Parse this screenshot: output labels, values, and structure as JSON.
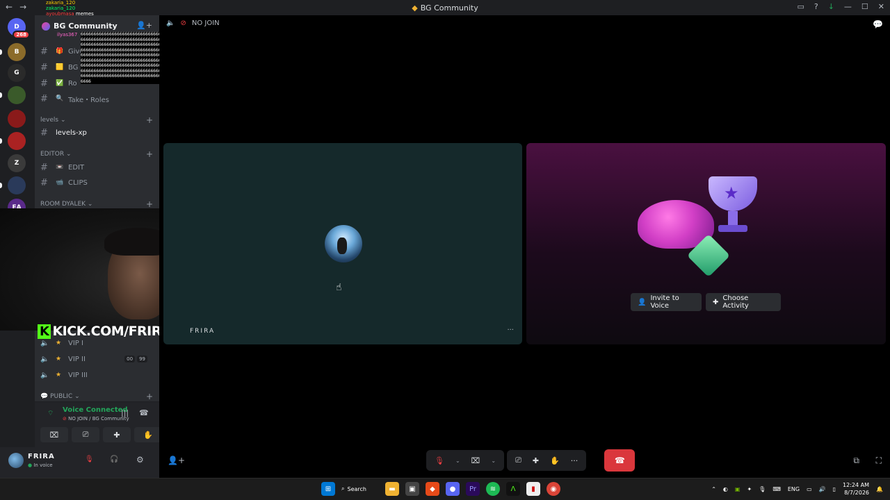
{
  "window": {
    "title": "BG Community",
    "back": "←",
    "forward": "→",
    "inbox_icon": "▭",
    "help_icon": "?",
    "download_icon": "↓",
    "minimize": "—",
    "maximize": "☐",
    "close": "✕"
  },
  "servers": [
    {
      "label": "D",
      "badge": "268",
      "color": "#5865f2"
    },
    {
      "label": "B",
      "badge": "",
      "color": "#8b6b2a"
    },
    {
      "label": "G",
      "badge": "",
      "color": "#2a2a2a"
    },
    {
      "label": "",
      "badge": "",
      "color": "#3a5a2a"
    },
    {
      "label": "",
      "badge": "",
      "color": "#8a1a1a"
    },
    {
      "label": "",
      "badge": "",
      "color": "#aa2222"
    },
    {
      "label": "Z",
      "badge": "",
      "color": "#3a3a3a"
    },
    {
      "label": "",
      "badge": "",
      "color": "#2a3a5a"
    },
    {
      "label": "EA",
      "badge": "",
      "color": "#5a2a8a"
    }
  ],
  "server": {
    "name": "BG Community",
    "invite_icon": "👤+"
  },
  "overlay_chat": {
    "line1": "zakaria_120",
    "line2": "zakaria_120",
    "line3_user": "ayoubmasa",
    "line3_text": "memes",
    "line4": "ilyas367"
  },
  "spam_text": "6666666666666666666666666666666666666666666666666666666666666666666666666666666666666666666666666666666666666666666666666666666666666666666666666666666666666666666666666666666666666666666666666666666666666666666666666666666666666666666666666666666666666666666666666666666666666666666666666666666666666666666666666666666666666666666666666666666666666666666666666666666666666666666666666666666666666666666666666666666666666666666",
  "channels_top": [
    {
      "emoji": "🎁",
      "label": "Give"
    },
    {
      "emoji": "🟨",
      "label": "BG"
    },
    {
      "emoji": "✅",
      "label": "Ro"
    },
    {
      "emoji": "🔍",
      "label": "Take・Roles"
    }
  ],
  "categories": {
    "levels": "levels",
    "editor": "EDITOR",
    "room": "ROOM DYALEK",
    "public": "PUBLIC"
  },
  "levels_channel": "levels-xp",
  "editor_channels": [
    {
      "emoji": "📼",
      "label": "EDIT"
    },
    {
      "emoji": "📹",
      "label": "CLIPS"
    }
  ],
  "vip_channels": [
    {
      "label": "VIP I",
      "counts": []
    },
    {
      "label": "VIP II",
      "counts": [
        "00",
        "99"
      ]
    },
    {
      "label": "VIP III",
      "counts": []
    }
  ],
  "voice": {
    "status": "Voice Connected",
    "location": "NO JOIN / BG Community",
    "wave_icon": "|||",
    "hangup_icon": "☎"
  },
  "voice_buttons": [
    "⌧",
    "⎚",
    "✚",
    "✋"
  ],
  "user": {
    "name": "FRIRA",
    "status": "In voice",
    "mic_icon": "🎙",
    "deafen_icon": "🎧",
    "settings_icon": "⚙"
  },
  "stream_overlay": {
    "kick_icon": "K",
    "kick_text": "KICK.COM/FRIRAA"
  },
  "call": {
    "channel_name": "NO JOIN",
    "participant_name": "FRIRA",
    "more_icon": "···",
    "invite_label": "Invite to Voice",
    "activity_label": "Choose Activity"
  },
  "controls": {
    "mic": "🎙",
    "camera": "⌧",
    "screen": "⎚",
    "activities": "✚",
    "soundboard": "✋",
    "more": "···",
    "leave": "☎"
  },
  "taskbar": {
    "search_label": "Search",
    "lang": "ENG",
    "time": "12:24 AM",
    "date": "8/7/2026"
  }
}
